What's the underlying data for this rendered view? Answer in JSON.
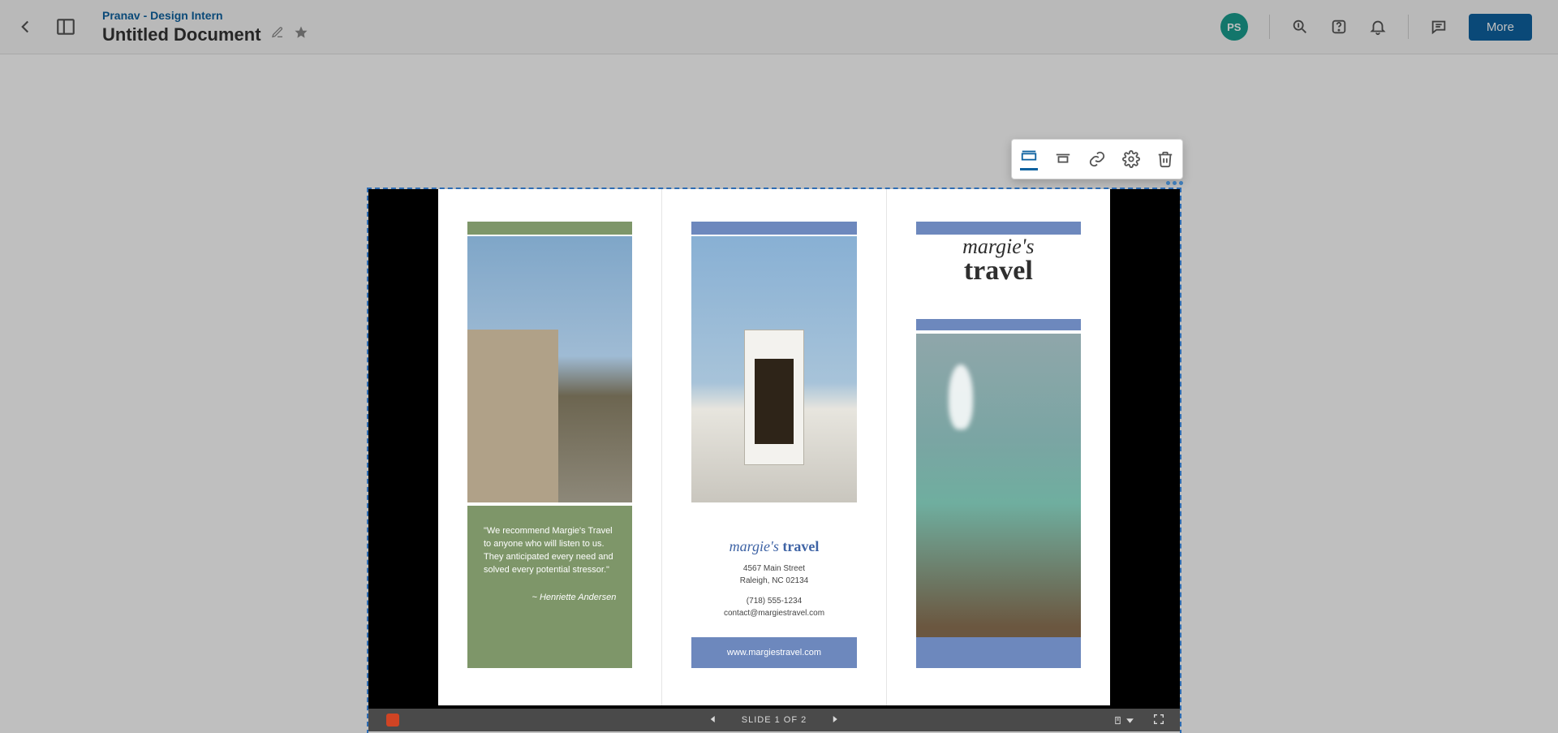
{
  "header": {
    "breadcrumb": "Pranav - Design Intern",
    "doc_title": "Untitled Document",
    "avatar_initials": "PS",
    "more_label": "More"
  },
  "float_toolbar": {
    "buttons": [
      "layout-fit-width",
      "layout-original-size",
      "link",
      "settings",
      "delete"
    ]
  },
  "viewer": {
    "slide_counter": "SLIDE 1 OF 2"
  },
  "brochure": {
    "panel1": {
      "quote": "\"We recommend Margie's Travel to anyone who will listen to us. They anticipated every need and solved every potential stressor.\"",
      "attribution": "~ Henriette Andersen"
    },
    "panel2": {
      "logo_italic": "margie's",
      "logo_bold": "travel",
      "address_line1": "4567 Main Street",
      "address_line2": "Raleigh, NC 02134",
      "phone": "(718) 555-1234",
      "email": "contact@margiestravel.com",
      "website": "www.margiestravel.com"
    },
    "panel3": {
      "title_italic": "margie's",
      "title_bold": "travel"
    }
  }
}
